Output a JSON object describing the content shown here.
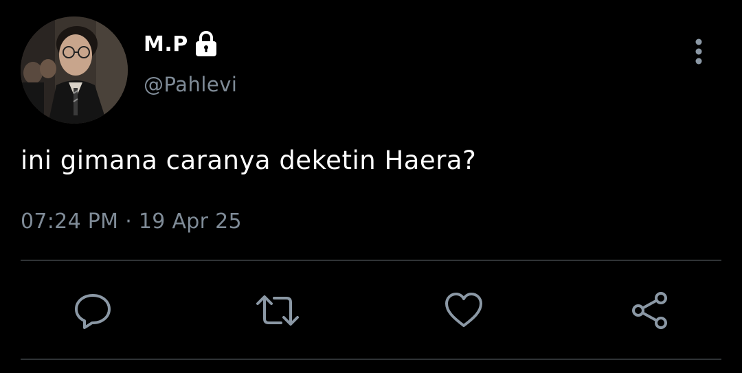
{
  "user": {
    "display_name": "M.P",
    "handle": "@Pahlevi",
    "protected_icon": "lock-icon",
    "avatar": "profile-photo"
  },
  "tweet": {
    "text": "ini gimana caranya deketin Haera?",
    "timestamp": "07:24 PM · 19 Apr 25"
  },
  "actions": [
    {
      "name": "reply",
      "icon": "comment-icon"
    },
    {
      "name": "retweet",
      "icon": "retweet-icon"
    },
    {
      "name": "like",
      "icon": "heart-icon"
    },
    {
      "name": "share",
      "icon": "share-icon"
    }
  ],
  "menu_icon": "more-vertical-icon",
  "colors": {
    "background": "#000000",
    "primary_text": "#ffffff",
    "secondary_text": "#7f8b97",
    "icon": "#8b98a5",
    "divider": "#2f3336"
  }
}
